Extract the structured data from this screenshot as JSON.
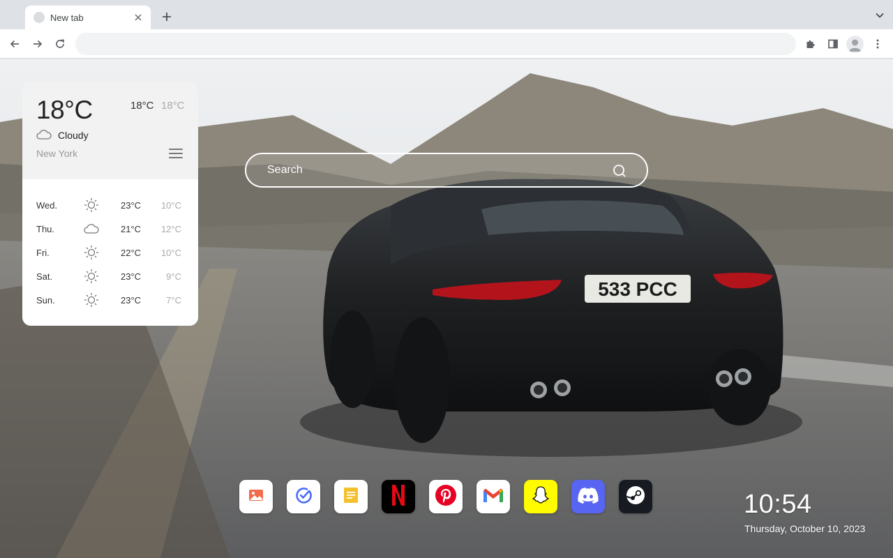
{
  "browser": {
    "tab": {
      "title": "New tab",
      "close_icon": "close-icon"
    },
    "new_tab_icon": "plus-icon",
    "omnibox": {
      "value": "",
      "placeholder": ""
    }
  },
  "weather": {
    "current": {
      "temp": "18°C",
      "high": "18°C",
      "low": "18°C",
      "condition": "Cloudy",
      "condition_icon": "cloud-icon",
      "city": "New York"
    },
    "forecast": [
      {
        "day": "Wed.",
        "icon": "sun-icon",
        "high": "23°C",
        "low": "10°C"
      },
      {
        "day": "Thu.",
        "icon": "cloud-icon",
        "high": "21°C",
        "low": "12°C"
      },
      {
        "day": "Fri.",
        "icon": "sun-icon",
        "high": "22°C",
        "low": "10°C"
      },
      {
        "day": "Sat.",
        "icon": "sun-icon",
        "high": "23°C",
        "low": "9°C"
      },
      {
        "day": "Sun.",
        "icon": "sun-icon",
        "high": "23°C",
        "low": "7°C"
      }
    ]
  },
  "search": {
    "placeholder": "Search"
  },
  "wallpaper": {
    "plate_text": "533 PCC"
  },
  "dock": {
    "apps": [
      {
        "name": "photos",
        "color": "#ffffff"
      },
      {
        "name": "tasks",
        "color": "#ffffff"
      },
      {
        "name": "notes",
        "color": "#ffffff"
      },
      {
        "name": "netflix",
        "color": "#000000"
      },
      {
        "name": "pinterest",
        "color": "#ffffff"
      },
      {
        "name": "gmail",
        "color": "#ffffff"
      },
      {
        "name": "snapchat",
        "color": "#FFFC00"
      },
      {
        "name": "discord",
        "color": "#5865F2"
      },
      {
        "name": "steam",
        "color": "#171a21"
      }
    ]
  },
  "clock": {
    "time": "10:54",
    "date": "Thursday, October 10, 2023"
  }
}
